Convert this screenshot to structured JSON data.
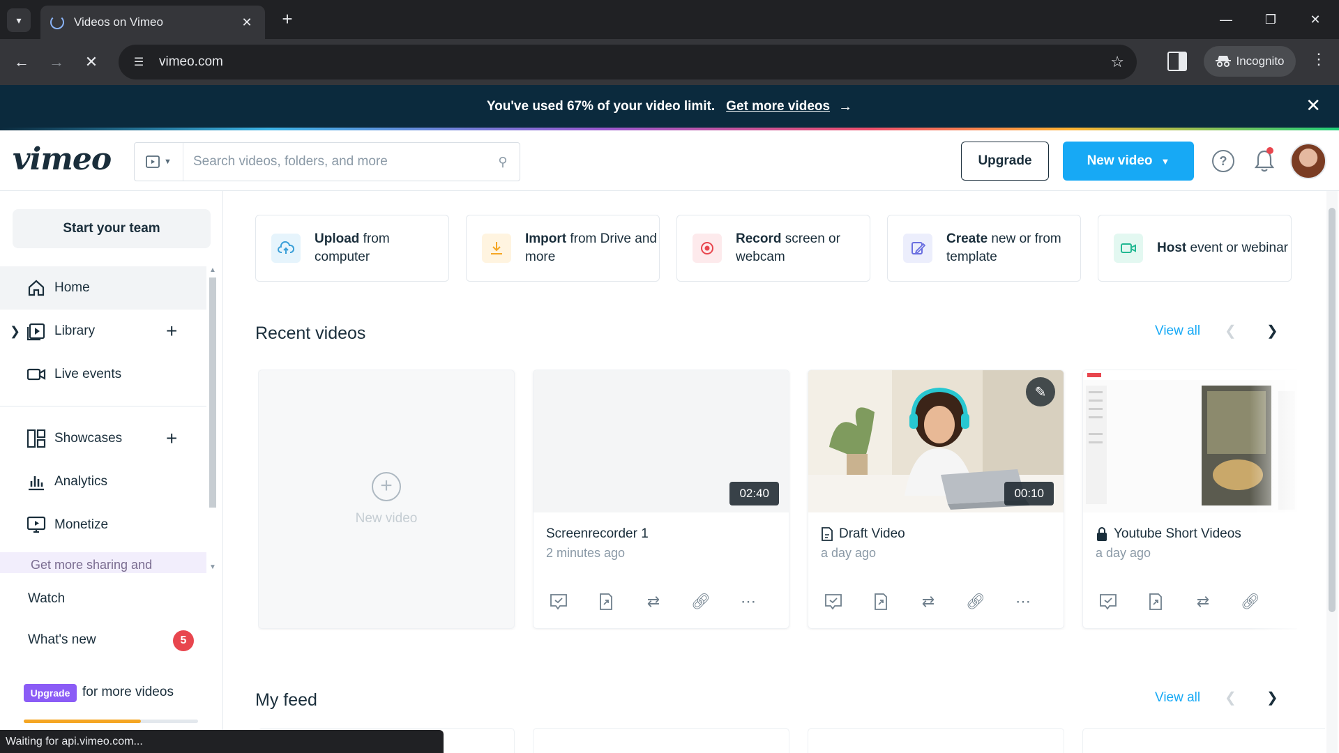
{
  "browser": {
    "tab_title": "Videos on Vimeo",
    "url": "vimeo.com",
    "incognito_label": "Incognito",
    "status_text": "Waiting for api.vimeo.com..."
  },
  "banner": {
    "message": "You've used 67% of your video limit.",
    "link": "Get more videos",
    "usage_percent": 67
  },
  "header": {
    "logo": "vimeo",
    "search_placeholder": "Search videos, folders, and more",
    "upgrade_label": "Upgrade",
    "new_video_label": "New video"
  },
  "sidebar": {
    "team_button": "Start your team",
    "items": [
      {
        "label": "Home",
        "icon": "home-icon"
      },
      {
        "label": "Library",
        "icon": "library-icon"
      },
      {
        "label": "Live events",
        "icon": "live-events-icon"
      },
      {
        "label": "Showcases",
        "icon": "showcases-icon"
      },
      {
        "label": "Analytics",
        "icon": "analytics-icon"
      },
      {
        "label": "Monetize",
        "icon": "monetize-icon"
      }
    ],
    "promo_text": "Get more sharing and",
    "watch": "Watch",
    "whats_new": "What's new",
    "whats_new_count": "5",
    "upgrade_badge": "Upgrade",
    "upgrade_text": "for more videos",
    "usage_fraction": 0.67
  },
  "quick_actions": [
    {
      "bold": "Upload",
      "rest": " from computer",
      "icon": "upload-cloud-icon",
      "color": "#3a9fd8",
      "bg": "#e6f4fc"
    },
    {
      "bold": "Import",
      "rest": " from Drive and more",
      "icon": "import-icon",
      "color": "#f5a623",
      "bg": "#fff4e0"
    },
    {
      "bold": "Record",
      "rest": " screen or webcam",
      "icon": "record-icon",
      "color": "#e8464e",
      "bg": "#fdeaec"
    },
    {
      "bold": "Create",
      "rest": " new or from template",
      "icon": "create-icon",
      "color": "#6a6fe0",
      "bg": "#eceefc"
    },
    {
      "bold": "Host",
      "rest": " event or webinar",
      "icon": "host-icon",
      "color": "#21b892",
      "bg": "#e3f8f1"
    }
  ],
  "recent_videos": {
    "title": "Recent videos",
    "view_all": "View all",
    "new_video_label": "New video",
    "items": [
      {
        "title": "Screenrecorder 1",
        "time": "2 minutes ago",
        "duration": "02:40"
      },
      {
        "title": "Draft Video",
        "time": "a day ago",
        "duration": "00:10"
      },
      {
        "title": "Youtube Short Videos",
        "time": "a day ago",
        "duration": ""
      }
    ]
  },
  "my_feed": {
    "title": "My feed",
    "view_all": "View all"
  },
  "colors": {
    "accent": "#17a9f5",
    "banner_bg": "#0b2a3d",
    "badge_red": "#e8464e",
    "upgrade_purple": "#8b5cf6"
  }
}
